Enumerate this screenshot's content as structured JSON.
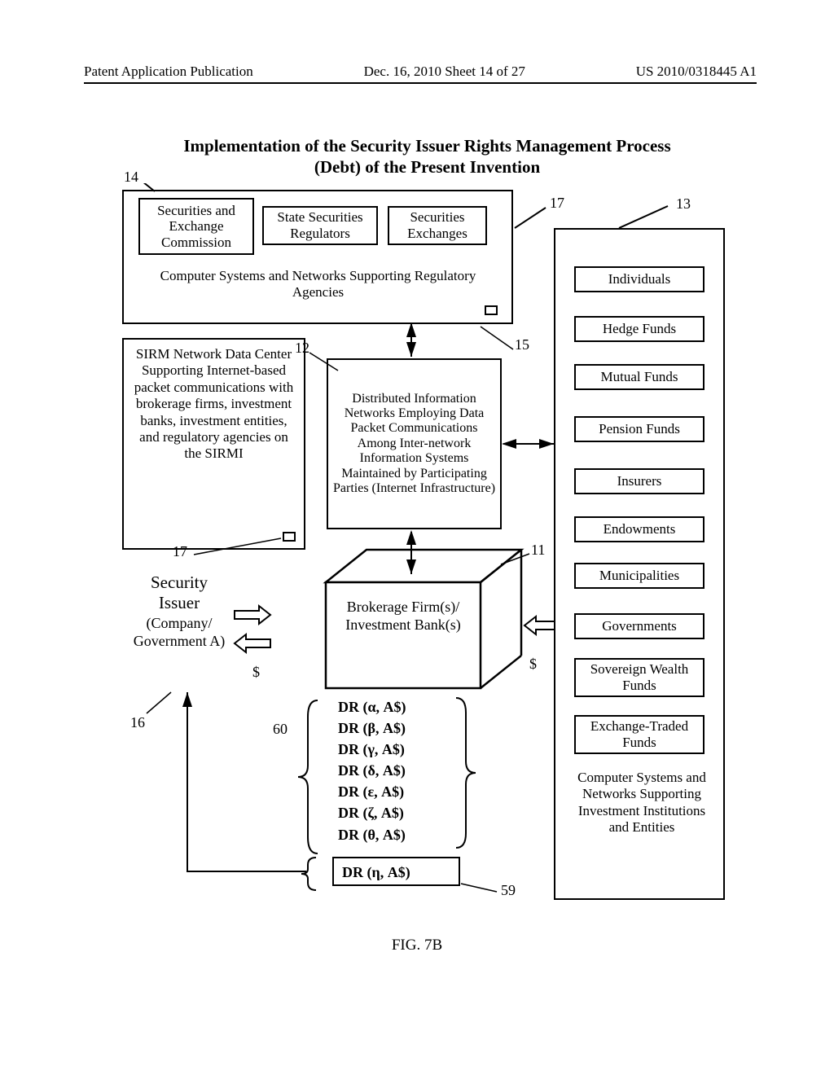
{
  "header": {
    "left": "Patent Application Publication",
    "center": "Dec. 16, 2010  Sheet 14 of 27",
    "right": "US 2010/0318445 A1"
  },
  "figTitle1": "Implementation of the Security Issuer Rights Management Process",
  "figTitle2": "(Debt) of the Present Invention",
  "figLabel": "FIG. 7B",
  "refs": {
    "r14": "14",
    "r12": "12",
    "r15": "15",
    "r17a": "17",
    "r17b": "17",
    "r13": "13",
    "r11": "11",
    "r16": "16",
    "r60": "60",
    "r59": "59"
  },
  "regTop": {
    "sec": "Securities and Exchange Commission",
    "state": "State Securities Regulators",
    "exch": "Securities Exchanges",
    "caption": "Computer Systems and Networks Supporting Regulatory Agencies"
  },
  "sirm": "SIRM Network Data Center Supporting Internet-based packet communications with brokerage firms, investment banks, investment entities, and regulatory agencies on the SIRMI",
  "distNet": "Distributed Information Networks Employing Data Packet Communications Among Inter-network Information Systems Maintained by Participating Parties (Internet Infrastructure)",
  "issuer": {
    "title": "Security Issuer",
    "body": "(Company/ Government A)"
  },
  "brokerage": "Brokerage Firm(s)/ Investment Bank(s)",
  "entities": {
    "e0": "Individuals",
    "e1": "Hedge Funds",
    "e2": "Mutual Funds",
    "e3": "Pension Funds",
    "e4": "Insurers",
    "e5": "Endowments",
    "e6": "Municipalities",
    "e7": "Governments",
    "e8": "Sovereign Wealth Funds",
    "e9": "Exchange-Traded Funds",
    "caption": "Computer Systems and Networks Supporting Investment Institutions and Entities"
  },
  "dr": {
    "d0": "DR (α, A$)",
    "d1": "DR (β, A$)",
    "d2": "DR (γ, A$)",
    "d3": "DR (δ, A$)",
    "d4": "DR (ε, A$)",
    "d5": "DR (ζ, A$)",
    "d6": "DR (θ, A$)",
    "d7": "DR (η, A$)"
  },
  "dollar": "$"
}
